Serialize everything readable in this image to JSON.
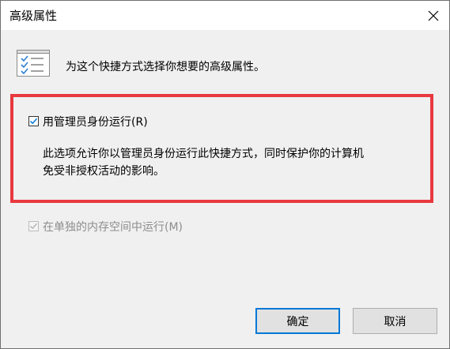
{
  "window": {
    "title": "高级属性",
    "close_icon": "close-icon"
  },
  "header": {
    "icon": "checklist-icon",
    "text": "为这个快捷方式选择你想要的高级属性。"
  },
  "options": {
    "run_as_admin": {
      "label": "用管理员身份运行(R)",
      "checked": true,
      "enabled": true,
      "description_line1": "此选项允许你以管理员身份运行此快捷方式，同时保护你的计算机",
      "description_line2": "免受非授权活动的影响。"
    },
    "separate_memory": {
      "label": "在单独的内存空间中运行(M)",
      "checked": true,
      "enabled": false
    }
  },
  "buttons": {
    "ok_label": "确定",
    "cancel_label": "取消"
  },
  "colors": {
    "highlight_border": "#e8393f",
    "default_button_border": "#0078d7",
    "checkmark": "#0078d7",
    "disabled_text": "#8d8d8d"
  }
}
